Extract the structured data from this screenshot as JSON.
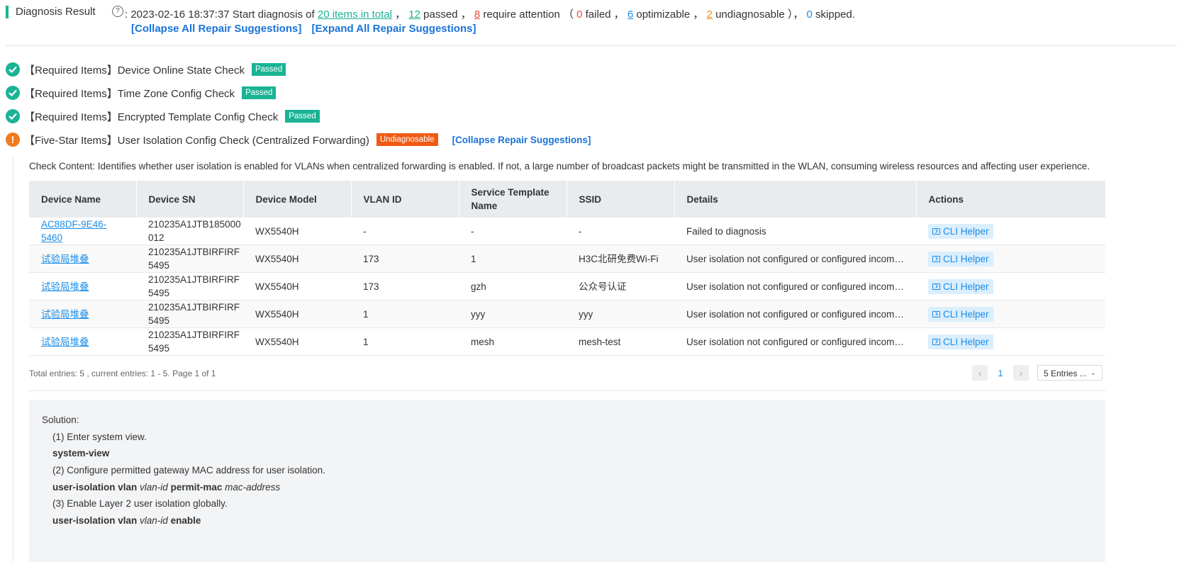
{
  "header": {
    "title": "Diagnosis Result",
    "help_icon": "?",
    "prefix": ":",
    "datetime_text": "2023-02-16 18:37:37 Start diagnosis of",
    "total_items": "20 items in total",
    "passed_count": "12",
    "passed_label": "passed",
    "attention_count": "8",
    "attention_label": "require attention",
    "failed_count": "0",
    "failed_label": "failed",
    "optimizable_count": "6",
    "optimizable_label": "optimizable",
    "undiagnosable_count": "2",
    "undiagnosable_label": "undiagnosable",
    "skipped_count": "0",
    "skipped_label": "skipped.",
    "collapse_all": "[Collapse All Repair Suggestions]",
    "expand_all": "[Expand All Repair Suggestions]"
  },
  "checks": [
    {
      "label": "【Required Items】Device Online State Check",
      "status": "Passed"
    },
    {
      "label": "【Required Items】Time Zone Config Check",
      "status": "Passed"
    },
    {
      "label": "【Required Items】Encrypted Template Config Check",
      "status": "Passed"
    },
    {
      "label": "【Five-Star Items】User Isolation Config Check (Centralized Forwarding)",
      "status": "Undiagnosable",
      "action": "[Collapse Repair Suggestions]"
    }
  ],
  "status_icons": {
    "passed": "check-circle",
    "warning": "exclamation-circle"
  },
  "colors": {
    "green": "#1ab394",
    "orange": "#f05a14",
    "blue": "#1a8de8",
    "red": "#e84c3d"
  },
  "detail": {
    "check_content": "Check Content: Identifies whether user isolation is enabled for VLANs when centralized forwarding is enabled. If not, a large number of broadcast packets might be transmitted in the WLAN, consuming wireless resources and affecting user experience.",
    "columns": [
      "Device Name",
      "Device SN",
      "Device Model",
      "VLAN ID",
      "Service Template Name",
      "SSID",
      "Details",
      "Actions"
    ],
    "rows": [
      {
        "name": "AC88DF-9E46-5460",
        "sn": "210235A1JTB185000012",
        "model": "WX5540H",
        "vlan": "-",
        "template": "-",
        "ssid": "-",
        "details": "Failed to diagnosis",
        "action": "CLI Helper"
      },
      {
        "name": "试验局堆叠",
        "sn": "210235A1JTBIRFIRF5495",
        "model": "WX5540H",
        "vlan": "173",
        "template": "1",
        "ssid": "H3C北研免费Wi-Fi",
        "details": "User isolation not configured or configured incomplet...",
        "action": "CLI Helper"
      },
      {
        "name": "试验局堆叠",
        "sn": "210235A1JTBIRFIRF5495",
        "model": "WX5540H",
        "vlan": "173",
        "template": "gzh",
        "ssid": "公众号认证",
        "details": "User isolation not configured or configured incomplet...",
        "action": "CLI Helper"
      },
      {
        "name": "试验局堆叠",
        "sn": "210235A1JTBIRFIRF5495",
        "model": "WX5540H",
        "vlan": "1",
        "template": "yyy",
        "ssid": "yyy",
        "details": "User isolation not configured or configured incomplet...",
        "action": "CLI Helper"
      },
      {
        "name": "试验局堆叠",
        "sn": "210235A1JTBIRFIRF5495",
        "model": "WX5540H",
        "vlan": "1",
        "template": "mesh",
        "ssid": "mesh-test",
        "details": "User isolation not configured or configured incomplet...",
        "action": "CLI Helper"
      }
    ],
    "pagination": {
      "total_text": "Total entries: 5 , current entries: 1 - 5. Page 1 of 1",
      "prev": "‹",
      "current_page": "1",
      "next": "›",
      "page_size": "5 Entries ...",
      "page_size_chevron": "⌄"
    },
    "solution": {
      "title": "Solution:",
      "step1": "(1) Enter system view.",
      "cmd1": "system-view",
      "step2": "(2) Configure permitted gateway MAC address for user isolation.",
      "cmd2_a": "user-isolation vlan",
      "cmd2_b": "vlan-id",
      "cmd2_c": "permit-mac",
      "cmd2_d": "mac-address",
      "step3": "(3) Enable Layer 2 user isolation globally.",
      "cmd3_a": "user-isolation vlan",
      "cmd3_b": "vlan-id",
      "cmd3_c": "enable"
    }
  }
}
